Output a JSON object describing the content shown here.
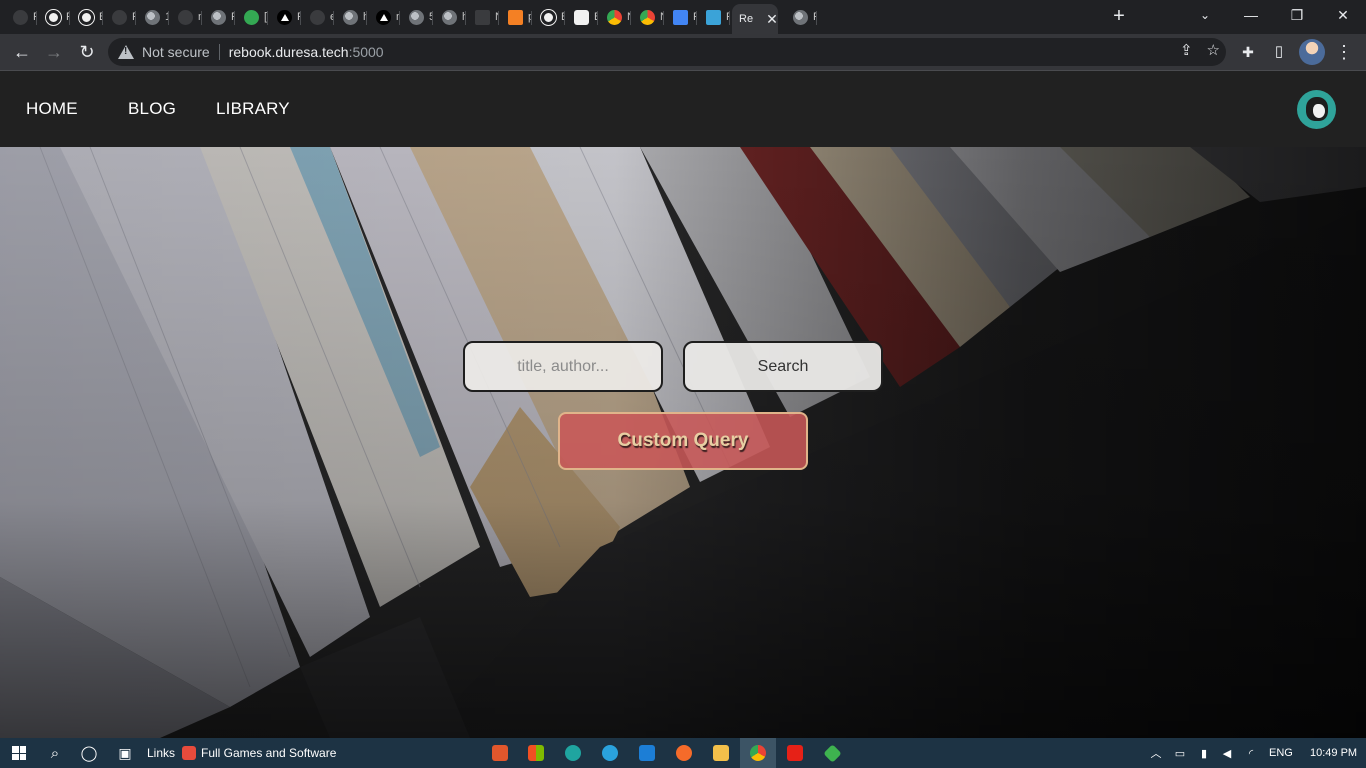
{
  "browser": {
    "tabs": [
      {
        "label": "P",
        "icon": "dim-icon"
      },
      {
        "label": "R",
        "icon": "github-icon"
      },
      {
        "label": "B",
        "icon": "github-icon"
      },
      {
        "label": "R",
        "icon": "github-dim-icon"
      },
      {
        "label": "1",
        "icon": "globe-icon"
      },
      {
        "label": "n",
        "icon": "github-dim-icon"
      },
      {
        "label": "R",
        "icon": "globe-icon"
      },
      {
        "label": "[",
        "icon": "gear-icon"
      },
      {
        "label": "P",
        "icon": "vercel-icon"
      },
      {
        "label": "e",
        "icon": "github-dim-icon"
      },
      {
        "label": "h",
        "icon": "globe-icon"
      },
      {
        "label": "n",
        "icon": "vercel-icon"
      },
      {
        "label": "5",
        "icon": "globe-icon"
      },
      {
        "label": "h",
        "icon": "globe-icon"
      },
      {
        "label": "N",
        "icon": "mailbox-icon"
      },
      {
        "label": "p",
        "icon": "stackoverflow-icon"
      },
      {
        "label": "B",
        "icon": "github-icon"
      },
      {
        "label": "B",
        "icon": "notion-icon"
      },
      {
        "label": "N",
        "icon": "chrome-icon"
      },
      {
        "label": "N",
        "icon": "chrome-icon"
      },
      {
        "label": "R",
        "icon": "docs-icon"
      },
      {
        "label": "R",
        "icon": "image-icon"
      },
      {
        "label": "Re",
        "icon": "",
        "active": true
      },
      {
        "label": "R",
        "icon": "globe-icon"
      }
    ],
    "new_tab_label": "+",
    "window_controls": {
      "tab_search": "⌄",
      "minimize": "—",
      "restore": "❐",
      "close": "✕"
    },
    "nav": {
      "back": "←",
      "forward": "→",
      "reload": "↻"
    },
    "address": {
      "security_label": "Not secure",
      "host": "rebook.duresa.tech",
      "port": ":5000"
    },
    "omnibox_icons": {
      "share": "⇪",
      "bookmark": "☆"
    },
    "toolbar_icons": {
      "extensions": "✚",
      "side_panel": "▯",
      "menu": "⋮"
    }
  },
  "site": {
    "nav": {
      "home": "HOME",
      "blog": "BLOG",
      "library": "LIBRARY"
    },
    "search": {
      "placeholder": "title, author...",
      "value": "",
      "button_label": "Search"
    },
    "custom_query_label": "Custom Query"
  },
  "taskbar": {
    "links_label": "Links",
    "toolbar_item": "Full Games and Software",
    "tray": {
      "language": "ENG",
      "time": "10:49 PM"
    }
  },
  "colors": {
    "navbar_bg": "#212121",
    "custom_query_bg": "#c85858",
    "custom_query_text": "#e7cfa3",
    "avatar_bg": "#2fa39a",
    "taskbar_bg": "#1d3344"
  }
}
